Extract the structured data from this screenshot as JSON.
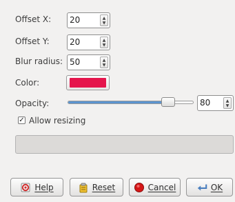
{
  "fields": {
    "offset_x": {
      "label": "Offset X:",
      "value": "20"
    },
    "offset_y": {
      "label": "Offset Y:",
      "value": "20"
    },
    "blur_radius": {
      "label": "Blur radius:",
      "value": "50"
    },
    "color": {
      "label": "Color:",
      "hex": "#e5154c"
    },
    "opacity": {
      "label": "Opacity:",
      "value": "80",
      "fraction": 0.8
    }
  },
  "checkbox": {
    "label": "Allow resizing",
    "checked": true,
    "mark": "✓"
  },
  "spin_arrows": {
    "up": "▲",
    "down": "▼"
  },
  "buttons": {
    "help": {
      "label": "Help",
      "icon": "help-icon"
    },
    "reset": {
      "label": "Reset",
      "icon": "reset-icon"
    },
    "cancel": {
      "label": "Cancel",
      "icon": "cancel-icon"
    },
    "ok": {
      "label": "OK",
      "icon": "ok-icon"
    }
  },
  "colors": {
    "accent": "#5b94cf",
    "swatch": "#e5154c",
    "cancel_red": "#d51717"
  }
}
